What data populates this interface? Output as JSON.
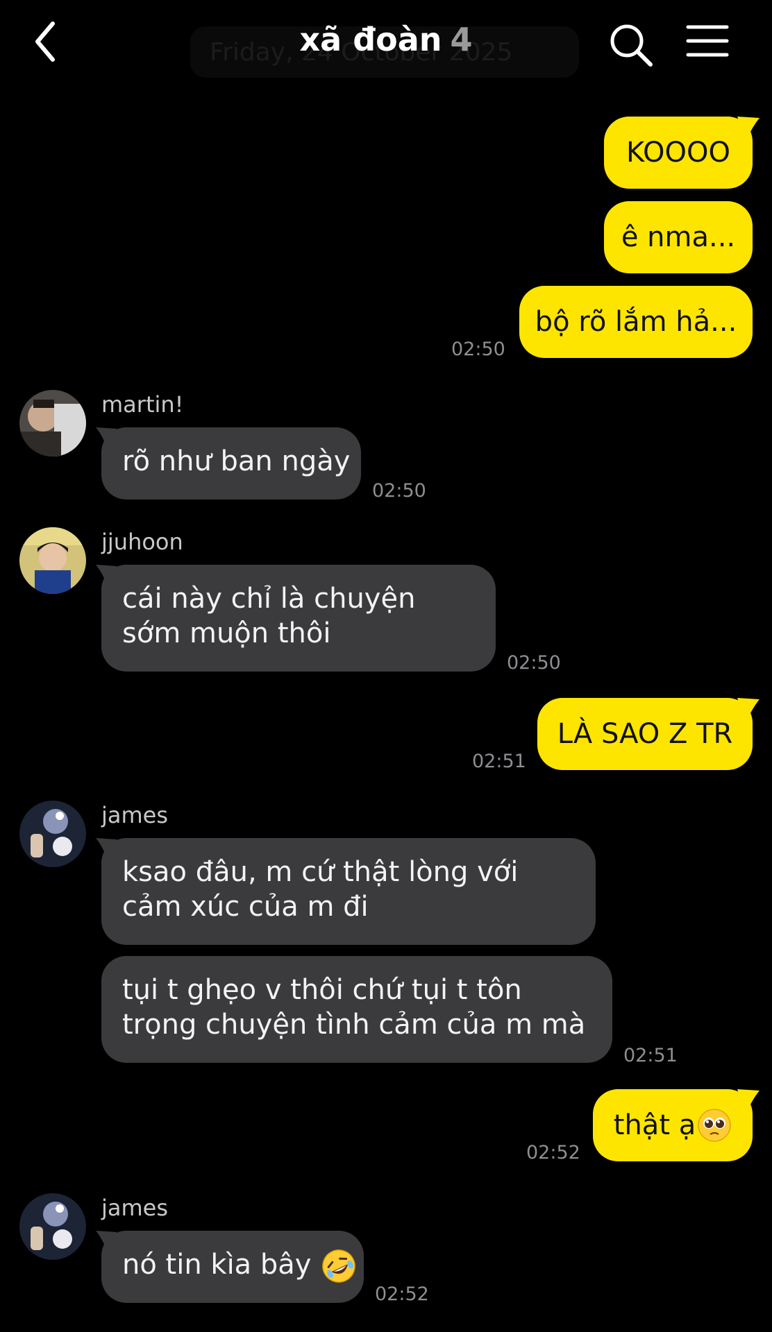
{
  "header": {
    "date": "Friday, 24 October 2025",
    "title": "xã đoàn",
    "member_count": "4"
  },
  "messages": {
    "m1": "KOOOO",
    "m2": "ê nma...",
    "m3": "bộ rõ lắm hả...",
    "m3_time": "02:50",
    "m4_sender": "martin!",
    "m4": "rõ như ban ngày",
    "m4_time": "02:50",
    "m5_sender": "jjuhoon",
    "m5": "cái này chỉ là chuyện sớm muộn thôi",
    "m5_time": "02:50",
    "m6": "LÀ SAO Z TR",
    "m6_time": "02:51",
    "m7_sender": "james",
    "m7": "ksao đâu, m cứ thật lòng với cảm xúc của m đi",
    "m8": "tụi t ghẹo v thôi chứ tụi t tôn trọng chuyện tình cảm của m mà",
    "m8_time": "02:51",
    "m9": "thật ạ",
    "m9_time": "02:52",
    "m10_sender": "james",
    "m10": "nó tin kìa bây",
    "m10_time": "02:52"
  },
  "icons": {
    "back": "chevron-left-icon",
    "search": "search-icon",
    "menu": "hamburger-menu-icon",
    "emoji_pleading": "pleading-face-emoji",
    "emoji_rofl": "rolling-on-floor-laughing-emoji"
  },
  "colors": {
    "outgoing_bubble": "#fee500",
    "incoming_bubble": "#3b3b3d",
    "background": "#000000"
  }
}
